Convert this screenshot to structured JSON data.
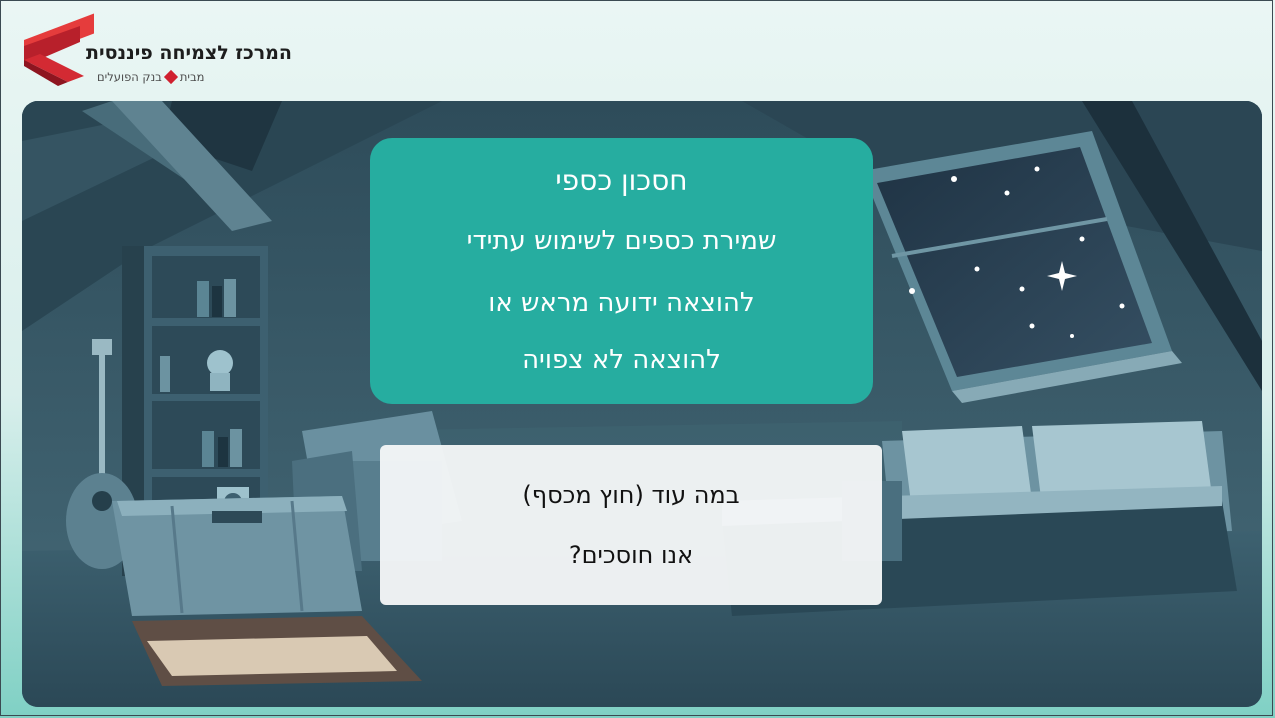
{
  "logo": {
    "title": "המרכז לצמיחה פיננסית",
    "sub_prefix": "מבית",
    "sub_bank": "בנק הפועלים"
  },
  "card": {
    "title": "חסכון כספי",
    "lines": [
      "שמירת כספים לשימוש עתידי",
      "להוצאה ידועה מראש או",
      "להוצאה לא צפויה"
    ]
  },
  "question": {
    "lines": [
      "במה עוד (חוץ מכסף)",
      "אנו חוסכים?"
    ]
  },
  "colors": {
    "brand_red": "#d0202f",
    "card_teal": "#26ada0",
    "scene_dark": "#3c5e6c"
  }
}
